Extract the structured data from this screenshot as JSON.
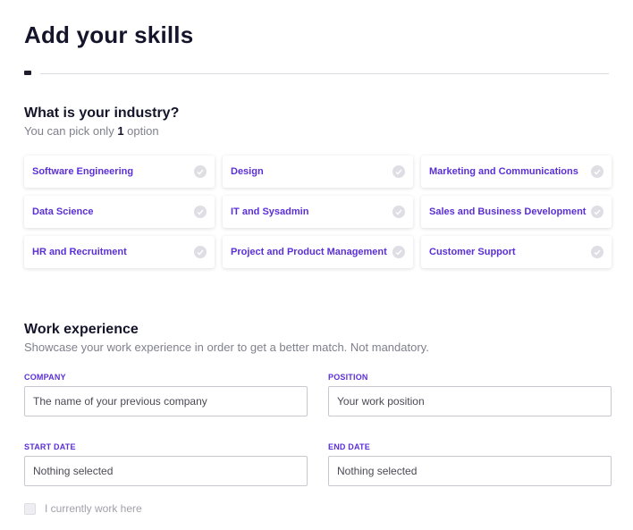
{
  "page": {
    "title": "Add your skills"
  },
  "industry": {
    "title": "What is your industry?",
    "subtitle_prefix": "You can pick only ",
    "subtitle_count": "1",
    "subtitle_suffix": " option",
    "options": [
      "Software Engineering",
      "Design",
      "Marketing and Communications",
      "Data Science",
      "IT and Sysadmin",
      "Sales and Business Development",
      "HR and Recruitment",
      "Project and Product Management",
      "Customer Support"
    ]
  },
  "experience": {
    "title": "Work experience",
    "subtitle": "Showcase your work experience in order to get a better match. Not mandatory.",
    "company": {
      "label": "COMPANY",
      "placeholder": "The name of your previous company"
    },
    "position": {
      "label": "POSITION",
      "placeholder": "Your work position"
    },
    "start_date": {
      "label": "START DATE",
      "value": "Nothing selected"
    },
    "end_date": {
      "label": "END DATE",
      "value": "Nothing selected"
    },
    "current_job_label": "I currently work here"
  },
  "colors": {
    "accent": "#5a2fd6",
    "check_bg": "#dedee4",
    "text": "#14142b"
  }
}
